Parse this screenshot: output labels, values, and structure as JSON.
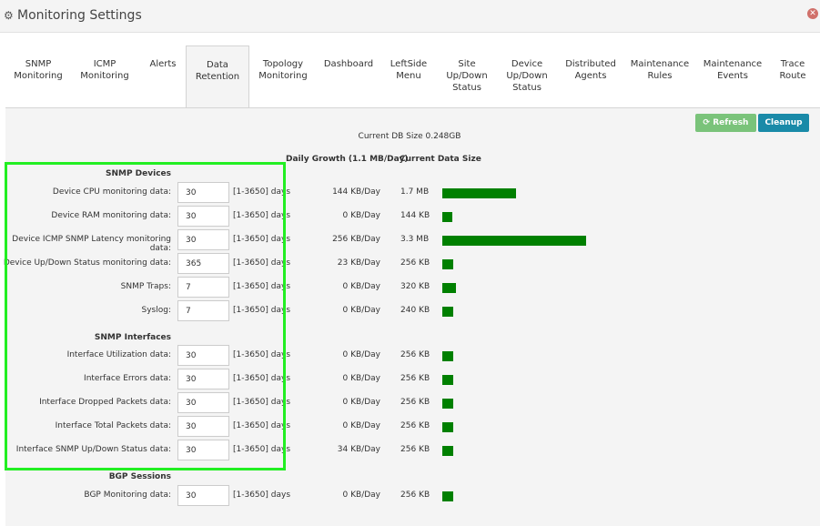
{
  "window": {
    "title": "Monitoring Settings",
    "title_icon": "gears-icon",
    "close_icon": "close-icon"
  },
  "tabs": [
    {
      "label": "SNMP\nMonitoring",
      "active": false
    },
    {
      "label": "ICMP\nMonitoring",
      "active": false
    },
    {
      "label": "Alerts",
      "active": false
    },
    {
      "label": "Data\nRetention",
      "active": true
    },
    {
      "label": "Topology\nMonitoring",
      "active": false
    },
    {
      "label": "Dashboard",
      "active": false
    },
    {
      "label": "LeftSide\nMenu",
      "active": false
    },
    {
      "label": "Site\nUp/Down\nStatus",
      "active": false
    },
    {
      "label": "Device\nUp/Down\nStatus",
      "active": false
    },
    {
      "label": "Distributed\nAgents",
      "active": false
    },
    {
      "label": "Maintenance\nRules",
      "active": false
    },
    {
      "label": "Maintenance\nEvents",
      "active": false
    },
    {
      "label": "Trace\nRoute",
      "active": false
    }
  ],
  "toolbar": {
    "refresh_label": "Refresh",
    "refresh_icon": "refresh-icon",
    "cleanup_label": "Cleanup"
  },
  "db_size": "Current DB Size 0.248GB",
  "columns": {
    "growth": "Daily Growth (1.1 MB/Day)",
    "size": "Current Data Size"
  },
  "colors": {
    "bar": "#008000",
    "highlight": "#22ee22",
    "refresh": "#5cb85c",
    "cleanup": "#1a8aa8"
  },
  "sections": [
    {
      "title": "SNMP Devices",
      "rows": [
        {
          "label": "Device CPU monitoring data:",
          "value": "30",
          "range": "[1-3650] days",
          "growth": "144 KB/Day",
          "size": "1.7 MB",
          "size_kb": 1740
        },
        {
          "label": "Device RAM monitoring data:",
          "value": "30",
          "range": "[1-3650] days",
          "growth": "0 KB/Day",
          "size": "144 KB",
          "size_kb": 144
        },
        {
          "label": "Device ICMP SNMP Latency monitoring data:",
          "value": "30",
          "range": "[1-3650] days",
          "growth": "256 KB/Day",
          "size": "3.3 MB",
          "size_kb": 3380
        },
        {
          "label": "Device Up/Down Status monitoring data:",
          "value": "365",
          "range": "[1-3650] days",
          "growth": "23 KB/Day",
          "size": "256 KB",
          "size_kb": 256
        },
        {
          "label": "SNMP Traps:",
          "value": "7",
          "range": "[1-3650] days",
          "growth": "0 KB/Day",
          "size": "320 KB",
          "size_kb": 320
        },
        {
          "label": "Syslog:",
          "value": "7",
          "range": "[1-3650] days",
          "growth": "0 KB/Day",
          "size": "240 KB",
          "size_kb": 256
        }
      ]
    },
    {
      "title": "SNMP Interfaces",
      "rows": [
        {
          "label": "Interface Utilization data:",
          "value": "30",
          "range": "[1-3650] days",
          "growth": "0 KB/Day",
          "size": "256 KB",
          "size_kb": 256
        },
        {
          "label": "Interface Errors data:",
          "value": "30",
          "range": "[1-3650] days",
          "growth": "0 KB/Day",
          "size": "256 KB",
          "size_kb": 256
        },
        {
          "label": "Interface Dropped Packets data:",
          "value": "30",
          "range": "[1-3650] days",
          "growth": "0 KB/Day",
          "size": "256 KB",
          "size_kb": 256
        },
        {
          "label": "Interface Total Packets data:",
          "value": "30",
          "range": "[1-3650] days",
          "growth": "0 KB/Day",
          "size": "256 KB",
          "size_kb": 256
        },
        {
          "label": "Interface SNMP Up/Down Status data:",
          "value": "30",
          "range": "[1-3650] days",
          "growth": "34 KB/Day",
          "size": "256 KB",
          "size_kb": 256
        }
      ]
    },
    {
      "title": "BGP Sessions",
      "rows": [
        {
          "label": "BGP Monitoring data:",
          "value": "30",
          "range": "[1-3650] days",
          "growth": "0 KB/Day",
          "size": "256 KB",
          "size_kb": 256
        }
      ]
    }
  ]
}
